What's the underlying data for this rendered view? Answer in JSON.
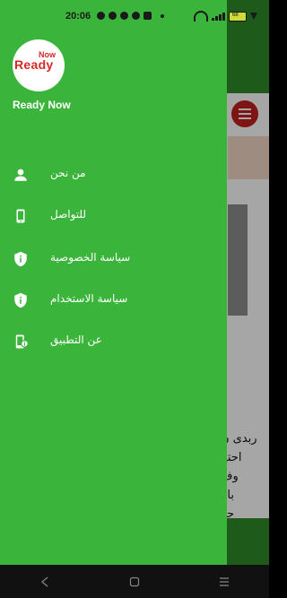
{
  "status_bar": {
    "time": "20:06",
    "battery": "68"
  },
  "app": {
    "text_lines": [
      "ربدى ن",
      "احتيا",
      "وف",
      "بالإ",
      "حة"
    ]
  },
  "drawer": {
    "logo": {
      "word_now": "Now",
      "word_ready": "Ready"
    },
    "app_name": "Ready Now",
    "items": [
      {
        "label": "من نحن",
        "icon": "person-icon"
      },
      {
        "label": "للتواصل",
        "icon": "phone-icon"
      },
      {
        "label": "سياسة الخصوصية",
        "icon": "shield-info-icon"
      },
      {
        "label": "سياسة الاستخدام",
        "icon": "shield-info-icon"
      },
      {
        "label": "عن التطبيق",
        "icon": "app-info-icon"
      }
    ]
  },
  "colors": {
    "drawer": "#3bb43b",
    "header": "#2f8d2a",
    "accent": "#c41f1f"
  }
}
